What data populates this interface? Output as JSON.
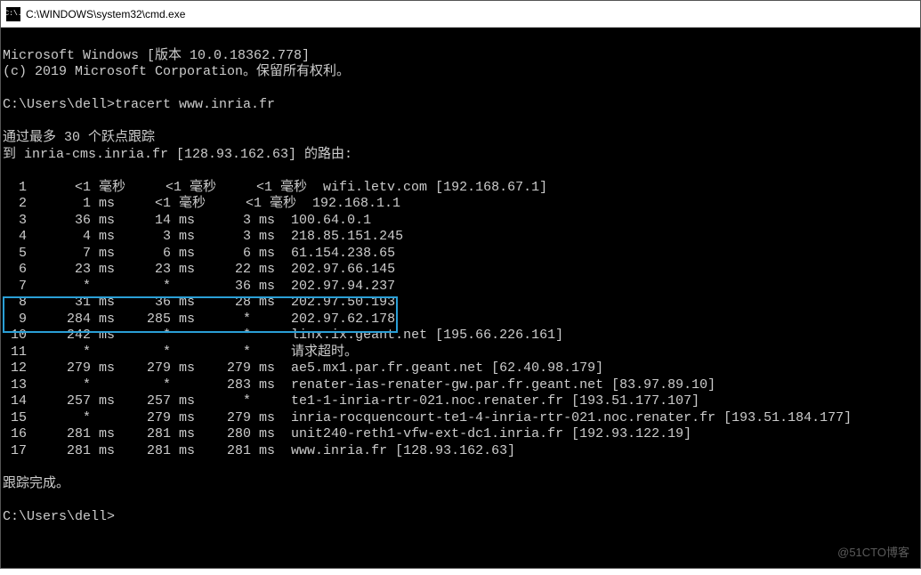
{
  "window": {
    "title": "C:\\WINDOWS\\system32\\cmd.exe",
    "icon_label": "C:\\."
  },
  "banner": {
    "line1": "Microsoft Windows [版本 10.0.18362.778]",
    "line2": "(c) 2019 Microsoft Corporation。保留所有权利。"
  },
  "prompt1": {
    "path": "C:\\Users\\dell>",
    "command": "tracert www.inria.fr"
  },
  "trace_header": {
    "line1": "通过最多 30 个跃点跟踪",
    "line2": "到 inria-cms.inria.fr [128.93.162.63] 的路由:"
  },
  "hops": [
    {
      "n": "1",
      "t1": "<1 毫秒",
      "t2": "<1 毫秒",
      "t3": "<1 毫秒",
      "host": "wifi.letv.com [192.168.67.1]"
    },
    {
      "n": "2",
      "t1": "1 ms",
      "t2": "<1 毫秒",
      "t3": "<1 毫秒",
      "host": "192.168.1.1"
    },
    {
      "n": "3",
      "t1": "36 ms",
      "t2": "14 ms",
      "t3": "3 ms",
      "host": "100.64.0.1"
    },
    {
      "n": "4",
      "t1": "4 ms",
      "t2": "3 ms",
      "t3": "3 ms",
      "host": "218.85.151.245"
    },
    {
      "n": "5",
      "t1": "7 ms",
      "t2": "6 ms",
      "t3": "6 ms",
      "host": "61.154.238.65"
    },
    {
      "n": "6",
      "t1": "23 ms",
      "t2": "23 ms",
      "t3": "22 ms",
      "host": "202.97.66.145"
    },
    {
      "n": "7",
      "t1": "*",
      "t2": "*",
      "t3": "36 ms",
      "host": "202.97.94.237"
    },
    {
      "n": "8",
      "t1": "31 ms",
      "t2": "36 ms",
      "t3": "28 ms",
      "host": "202.97.50.193"
    },
    {
      "n": "9",
      "t1": "284 ms",
      "t2": "285 ms",
      "t3": "*",
      "host": "202.97.62.178"
    },
    {
      "n": "10",
      "t1": "242 ms",
      "t2": "*",
      "t3": "*",
      "host": "linx.ix.geant.net [195.66.226.161]"
    },
    {
      "n": "11",
      "t1": "*",
      "t2": "*",
      "t3": "*",
      "host": "请求超时。"
    },
    {
      "n": "12",
      "t1": "279 ms",
      "t2": "279 ms",
      "t3": "279 ms",
      "host": "ae5.mx1.par.fr.geant.net [62.40.98.179]"
    },
    {
      "n": "13",
      "t1": "*",
      "t2": "*",
      "t3": "283 ms",
      "host": "renater-ias-renater-gw.par.fr.geant.net [83.97.89.10]"
    },
    {
      "n": "14",
      "t1": "257 ms",
      "t2": "257 ms",
      "t3": "*",
      "host": "te1-1-inria-rtr-021.noc.renater.fr [193.51.177.107]"
    },
    {
      "n": "15",
      "t1": "*",
      "t2": "279 ms",
      "t3": "279 ms",
      "host": "inria-rocquencourt-te1-4-inria-rtr-021.noc.renater.fr [193.51.184.177]"
    },
    {
      "n": "16",
      "t1": "281 ms",
      "t2": "281 ms",
      "t3": "280 ms",
      "host": "unit240-reth1-vfw-ext-dc1.inria.fr [192.93.122.19]"
    },
    {
      "n": "17",
      "t1": "281 ms",
      "t2": "281 ms",
      "t3": "281 ms",
      "host": "www.inria.fr [128.93.162.63]"
    }
  ],
  "trace_complete": "跟踪完成。",
  "prompt2": {
    "path": "C:\\Users\\dell>"
  },
  "watermark": "@51CTO博客"
}
